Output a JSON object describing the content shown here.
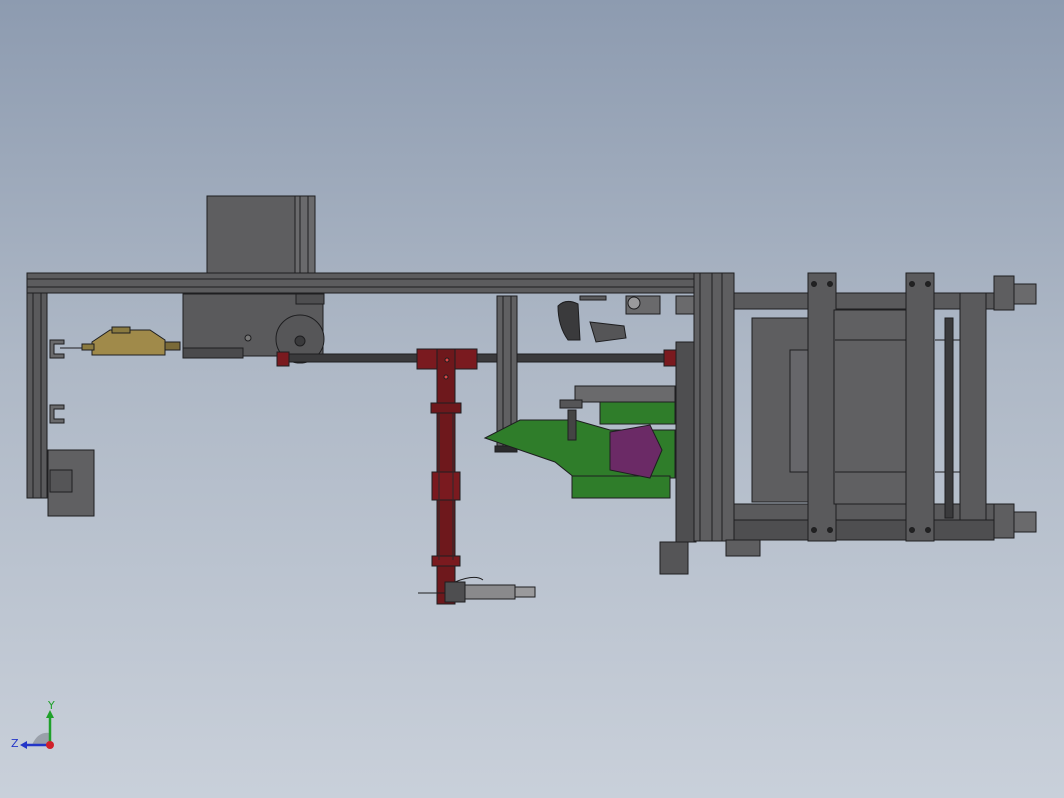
{
  "viewport": {
    "background_top": "#8d9bb0",
    "background_bottom": "#c9d0da"
  },
  "colors": {
    "frame": "#5a5a5c",
    "frame_dark": "#2f2f31",
    "part_red": "#7a1a1f",
    "part_green": "#2f7d2a",
    "part_purple": "#6b2a66",
    "part_tan": "#a08a4a"
  },
  "triad": {
    "x_label": "",
    "y_label": "Y",
    "z_label": "Z",
    "y_color": "#1fa02a",
    "z_color": "#2436c8",
    "x_color": "#d0202a"
  }
}
